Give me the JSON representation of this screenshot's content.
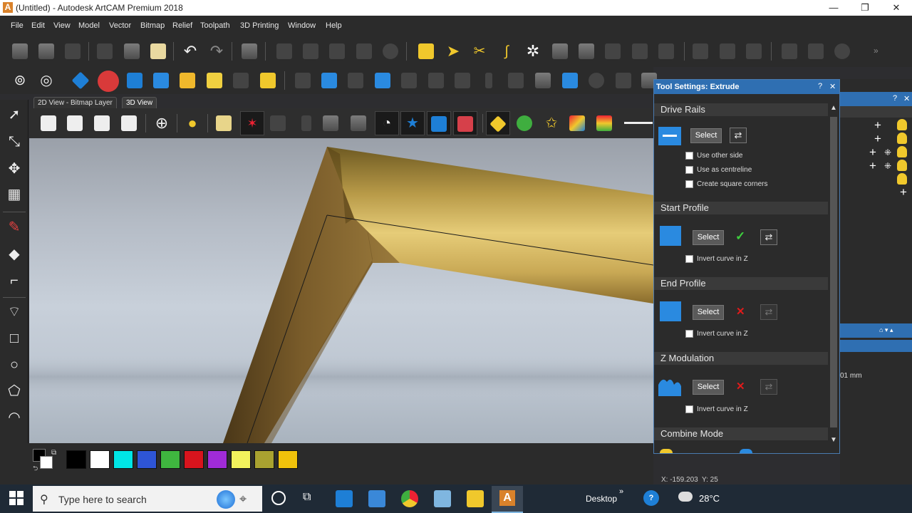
{
  "window": {
    "title": "(Untitled) - Autodesk ArtCAM Premium 2018",
    "app_logo": "A",
    "controls": {
      "minimize": "—",
      "maximize": "❐",
      "close": "✕"
    }
  },
  "menu": [
    "File",
    "Edit",
    "View",
    "Model",
    "Vector",
    "Bitmap",
    "Relief",
    "Toolpath",
    "3D Printing",
    "Window",
    "Help"
  ],
  "view_tabs": [
    "2D View - Bitmap Layer",
    "3D View"
  ],
  "tool_settings": {
    "title": "Tool Settings: Extrude",
    "help": "?",
    "close": "✕",
    "drive_rails": {
      "heading": "Drive Rails",
      "select_label": "Select",
      "options": [
        "Use other side",
        "Use as centreline",
        "Create square corners"
      ]
    },
    "start_profile": {
      "heading": "Start Profile",
      "select_label": "Select",
      "status": "✓",
      "invert_label": "Invert curve in Z"
    },
    "end_profile": {
      "heading": "End Profile",
      "select_label": "Select",
      "status": "✕",
      "invert_label": "Invert curve in Z"
    },
    "z_modulation": {
      "heading": "Z Modulation",
      "select_label": "Select",
      "status": "✕",
      "invert_label": "Invert curve in Z"
    },
    "combine_mode": {
      "heading": "Combine Mode"
    }
  },
  "right_panel": {
    "help": "?",
    "close": "✕",
    "measure_text": "01 mm"
  },
  "status": {
    "x_coord": "X: -159.203",
    "y_coord": "Y: 25"
  },
  "palette_colors": [
    "#000000",
    "#ffffff",
    "#00e5e5",
    "#2e55d6",
    "#3fb63f",
    "#d8141d",
    "#a02bd8",
    "#f2f25c",
    "#a9a230",
    "#f0c20b"
  ],
  "taskbar": {
    "search_placeholder": "Type here to search",
    "desktop_label": "Desktop",
    "chevron": "»",
    "temperature": "28°C"
  },
  "colors": {
    "accent": "#2f6fb2",
    "ok": "#3ecf3e",
    "error": "#e01b1b"
  }
}
